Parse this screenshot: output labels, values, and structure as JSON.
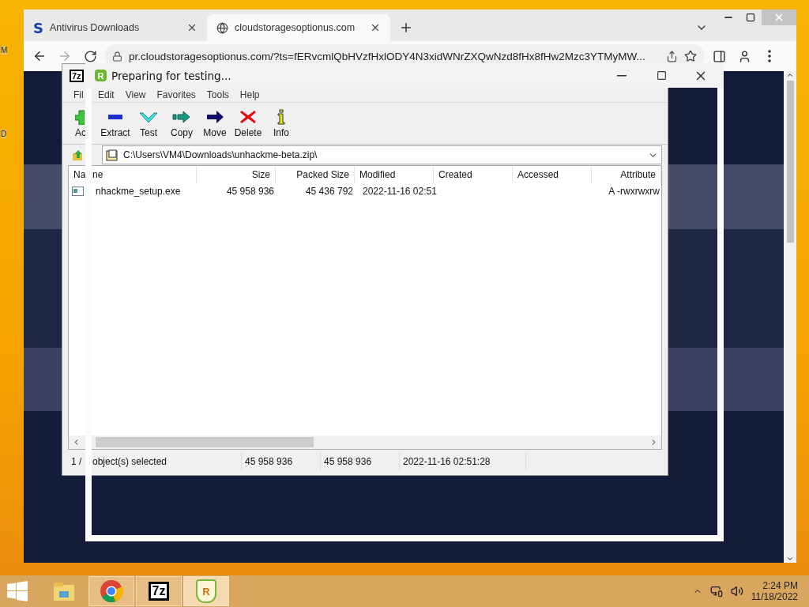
{
  "desktop": {
    "labels": [
      "M",
      "D"
    ]
  },
  "browser": {
    "tabs": [
      {
        "favicon": "S",
        "title": "Antivirus Downloads",
        "selected": false
      },
      {
        "title": "cloudstoragesoptionus.com",
        "selected": true
      }
    ],
    "back": {
      "disabled": false
    },
    "forward": {
      "disabled": true
    },
    "url": "pr.cloudstoragesoptionus.com/?ts=fERvcmlQbHVzfHxlODY4N3xidWNrZXQwNzd8fHx8fHw2Mzc3YTMyMW..."
  },
  "archiver": {
    "logo": "7z",
    "menu": [
      "Fil",
      "Edit",
      "View",
      "Favorites",
      "Tools",
      "Help"
    ],
    "toolbar": [
      {
        "kind": "add",
        "label": "Ac"
      },
      {
        "kind": "extract",
        "label": "Extract"
      },
      {
        "kind": "test",
        "label": "Test"
      },
      {
        "kind": "copy",
        "label": "Copy"
      },
      {
        "kind": "move",
        "label": "Move"
      },
      {
        "kind": "delete",
        "label": "Delete"
      },
      {
        "kind": "info",
        "label": "Info"
      }
    ],
    "path": "C:\\Users\\VM4\\Downloads\\unhackme-beta.zip\\",
    "name_column": {
      "head": "Na",
      "tail": "ne"
    },
    "columns": [
      {
        "label": "Size",
        "kind": "number"
      },
      {
        "label": "Packed Size",
        "kind": "number"
      },
      {
        "label": "Modified",
        "kind": "text"
      },
      {
        "label": "Created",
        "kind": "text"
      },
      {
        "label": "Accessed",
        "kind": "text"
      },
      {
        "label": "Attribute",
        "kind": "number"
      }
    ],
    "rows": [
      {
        "name": "nhackme_setup.exe",
        "size": "45 958 936",
        "packed_size": "45 436 792",
        "modified": "2022-11-16 02:51",
        "attributes": "A -rwxrwxrw"
      }
    ],
    "status": {
      "head": "1 /",
      "selection": "object(s) selected",
      "cells": [
        "45 958 936",
        "45 958 936",
        "2022-11-16 02:51:28"
      ]
    }
  },
  "dialog": {
    "logo": "R",
    "title": "Preparing for testing..."
  },
  "taskbar": {
    "items": [
      {
        "kind": "explorer",
        "running": false,
        "active": false
      },
      {
        "kind": "chrome",
        "running": true,
        "active": false
      },
      {
        "kind": "sevenzip",
        "text": "7z",
        "running": true,
        "active": false
      },
      {
        "kind": "shield",
        "text": "R",
        "running": true,
        "active": true
      }
    ],
    "time": "2:24 PM",
    "date": "11/18/2022"
  }
}
